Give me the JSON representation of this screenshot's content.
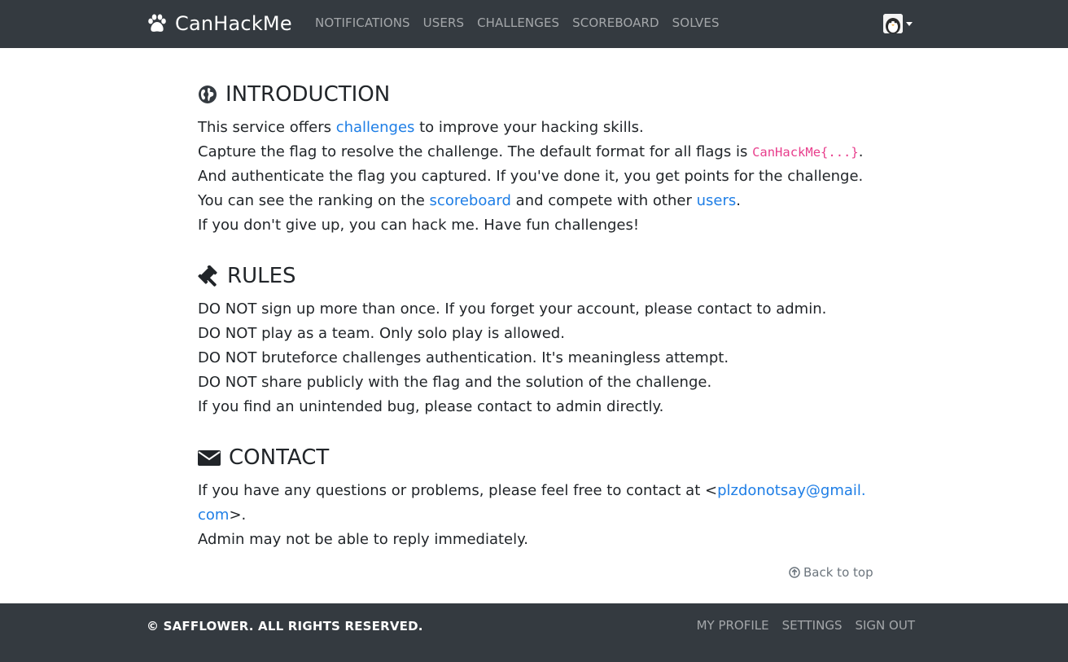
{
  "navbar": {
    "brand": "CanHackMe",
    "brand_icon": "paw-icon",
    "links": [
      "NOTIFICATIONS",
      "USERS",
      "CHALLENGES",
      "SCOREBOARD",
      "SOLVES"
    ],
    "user_avatar": "penguin-avatar",
    "user_menu_icon": "caret-down-icon",
    "bg_color": "#343a40"
  },
  "introduction": {
    "title": "INTRODUCTION",
    "icon": "globe-icon",
    "line1": {
      "before": "This service offers ",
      "link": "challenges",
      "after": " to improve your hacking skills."
    },
    "line2": {
      "before": "Capture the flag to resolve the challenge. The default format for all flags is ",
      "code": "CanHackMe{...}",
      "after": "."
    },
    "line3": "And authenticate the flag you captured. If you've done it, you get points for the challenge.",
    "line4": {
      "before": "You can see the ranking on the ",
      "link1": "scoreboard",
      "middle": " and compete with other ",
      "link2": "users",
      "after": "."
    },
    "line5": "If you don't give up, you can hack me. Have fun challenges!"
  },
  "rules": {
    "title": "RULES",
    "icon": "gavel-icon",
    "items": [
      "DO NOT sign up more than once. If you forget your account, please contact to admin.",
      "DO NOT play as a team. Only solo play is allowed.",
      "DO NOT bruteforce challenges authentication. It's meaningless attempt.",
      "DO NOT share publicly with the flag and the solution of the challenge.",
      "If you find an unintended bug, please contact to admin directly."
    ]
  },
  "contact": {
    "title": "CONTACT",
    "icon": "envelope-icon",
    "text_before": "If you have any questions or problems, please feel free to contact at <",
    "email": "plzdonotsay@gmail.com",
    "text_after": ">.",
    "line2": "Admin may not be able to reply immediately."
  },
  "back_to_top": {
    "label": "Back to top",
    "icon": "arrow-circle-up-icon"
  },
  "footer": {
    "copyright": "© SAFFLOWER. ALL RIGHTS RESERVED.",
    "links": [
      "MY PROFILE",
      "SETTINGS",
      "SIGN OUT"
    ]
  },
  "colors": {
    "link": "#1e7ee6",
    "code": "#e83e8c",
    "text": "#212529",
    "muted": "#6c757d"
  }
}
